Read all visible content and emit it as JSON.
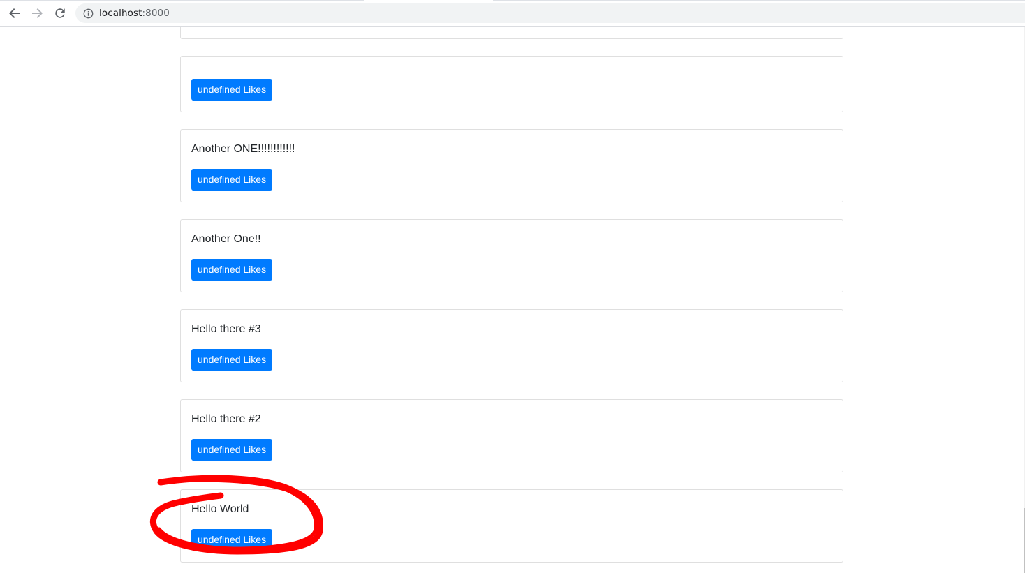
{
  "browser": {
    "url_host": "localhost",
    "url_port": ":8000",
    "icons": {
      "back": "back-arrow-icon",
      "forward": "forward-arrow-icon",
      "reload": "reload-icon",
      "info": "info-icon"
    }
  },
  "posts": [
    {
      "title": "",
      "like_label": "undefined Likes"
    },
    {
      "title": "Another ONE!!!!!!!!!!!!",
      "like_label": "undefined Likes"
    },
    {
      "title": "Another One!!",
      "like_label": "undefined Likes"
    },
    {
      "title": "Hello there #3",
      "like_label": "undefined Likes"
    },
    {
      "title": "Hello there #2",
      "like_label": "undefined Likes"
    },
    {
      "title": "Hello World",
      "like_label": "undefined Likes"
    }
  ],
  "colors": {
    "button": "#007bff",
    "annotation": "#ff0000",
    "card_border": "#dfdfdf"
  }
}
